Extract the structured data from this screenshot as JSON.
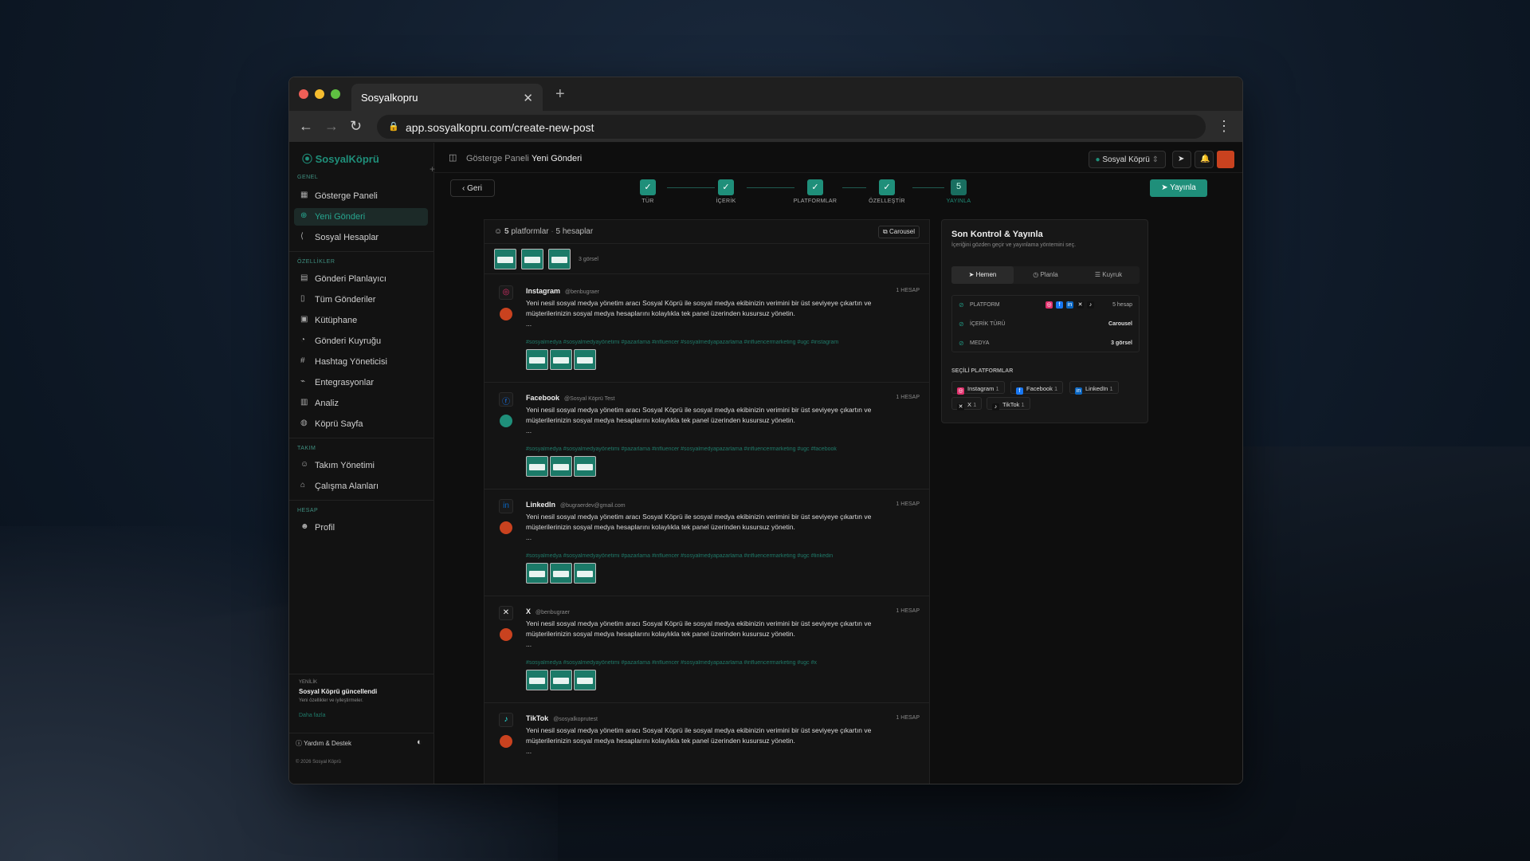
{
  "browser": {
    "tab_title": "Sosyalkopru",
    "url": "app.sosyalkopru.com/create-new-post"
  },
  "sidebar": {
    "logo": "SosyalKöprü",
    "sections": {
      "genel": "GENEL",
      "ozellikler": "ÖZELLİKLER",
      "takim": "TAKIM",
      "hesap": "HESAP"
    },
    "items": [
      {
        "label": "Gösterge Paneli"
      },
      {
        "label": "Yeni Gönderi"
      },
      {
        "label": "Sosyal Hesaplar"
      },
      {
        "label": "Gönderi Planlayıcı"
      },
      {
        "label": "Tüm Gönderiler"
      },
      {
        "label": "Kütüphane"
      },
      {
        "label": "Gönderi Kuyruğu"
      },
      {
        "label": "Hashtag Yöneticisi"
      },
      {
        "label": "Entegrasyonlar"
      },
      {
        "label": "Analiz"
      },
      {
        "label": "Köprü Sayfa"
      },
      {
        "label": "Takım Yönetimi"
      },
      {
        "label": "Çalışma Alanları"
      },
      {
        "label": "Profil"
      }
    ],
    "update": {
      "tag": "YENİLİK",
      "title": "Sosyal Köprü güncellendi",
      "desc": "Yeni özellikler ve iyileştirmeler.",
      "more": "Daha fazla"
    },
    "help": "Yardım & Destek",
    "copyright": "© 2026 Sosyal Köprü"
  },
  "topbar": {
    "crumb1": "Gösterge Paneli",
    "crumb2": "Yeni Gönderi",
    "workspace": "Sosyal Köprü"
  },
  "steps": [
    {
      "label": "TÜR"
    },
    {
      "label": "İÇERİK"
    },
    {
      "label": "PLATFORMLAR"
    },
    {
      "label": "ÖZELLEŞTİR"
    },
    {
      "label": "YAYINLA",
      "num": "5"
    }
  ],
  "back_label": "Geri",
  "publish_label": "Yayınla",
  "feed": {
    "platform_count": "5",
    "platform_word": "platformlar",
    "accounts": "5 hesaplar",
    "carousel": "Carousel",
    "images": "3 görsel",
    "posts": [
      {
        "platform": "Instagram",
        "handle": "@benbugraer",
        "acc": "1 HESAP",
        "text": "Yeni nesil sosyal medya yönetim aracı Sosyal Köprü ile sosyal medya ekibinizin verimini bir üst seviyeye çıkartın ve müşterilerinizin sosyal medya hesaplarını kolaylıkla tek panel üzerinden kusursuz yönetin.",
        "ellipsis": "...",
        "tags": "#sosyalmedya #sosyalmedyayönetimi #pazarlama #influencer #sosyalmedyapazarlama #influencermarketing #ugc #instagram"
      },
      {
        "platform": "Facebook",
        "handle": "@Sosyal Köprü Test",
        "acc": "1 HESAP",
        "text": "Yeni nesil sosyal medya yönetim aracı Sosyal Köprü ile sosyal medya ekibinizin verimini bir üst seviyeye çıkartın ve müşterilerinizin sosyal medya hesaplarını kolaylıkla tek panel üzerinden kusursuz yönetin.",
        "ellipsis": "...",
        "tags": "#sosyalmedya #sosyalmedyayönetimi #pazarlama #influencer #sosyalmedyapazarlama #influencermarketing #ugc #facebook"
      },
      {
        "platform": "LinkedIn",
        "handle": "@bugraerdev@gmail.com",
        "acc": "1 HESAP",
        "text": "Yeni nesil sosyal medya yönetim aracı Sosyal Köprü ile sosyal medya ekibinizin verimini bir üst seviyeye çıkartın ve müşterilerinizin sosyal medya hesaplarını kolaylıkla tek panel üzerinden kusursuz yönetin.",
        "ellipsis": "...",
        "tags": "#sosyalmedya #sosyalmedyayönetimi #pazarlama #influencer #sosyalmedyapazarlama #influencermarketing #ugc #linkedin"
      },
      {
        "platform": "X",
        "handle": "@benbugraer",
        "acc": "1 HESAP",
        "text": "Yeni nesil sosyal medya yönetim aracı Sosyal Köprü ile sosyal medya ekibinizin verimini bir üst seviyeye çıkartın ve müşterilerinizin sosyal medya hesaplarını kolaylıkla tek panel üzerinden kusursuz yönetin.",
        "ellipsis": "...",
        "tags": "#sosyalmedya #sosyalmedyayönetimi #pazarlama #influencer #sosyalmedyapazarlama #influencermarketing #ugc #x"
      },
      {
        "platform": "TikTok",
        "handle": "@sosyalkoprutest",
        "acc": "1 HESAP",
        "text": "Yeni nesil sosyal medya yönetim aracı Sosyal Köprü ile sosyal medya ekibinizin verimini bir üst seviyeye çıkartın ve müşterilerinizin sosyal medya hesaplarını kolaylıkla tek panel üzerinden kusursuz yönetin.",
        "ellipsis": "..."
      }
    ]
  },
  "panel": {
    "title": "Son Kontrol & Yayınla",
    "subtitle": "İçeriğini gözden geçir ve yayınlama yöntemini seç.",
    "tabs": [
      "Hemen",
      "Planla",
      "Kuyruk"
    ],
    "rows": [
      {
        "label": "PLATFORM",
        "value": "5 hesap"
      },
      {
        "label": "İÇERİK TÜRÜ",
        "value": "Carousel"
      },
      {
        "label": "MEDYA",
        "value": "3 görsel"
      }
    ],
    "selected_title": "SEÇİLİ PLATFORMLAR",
    "chips": [
      {
        "name": "Instagram",
        "n": "1"
      },
      {
        "name": "Facebook",
        "n": "1"
      },
      {
        "name": "LinkedIn",
        "n": "1"
      },
      {
        "name": "X",
        "n": "1"
      },
      {
        "name": "TikTok",
        "n": "1"
      }
    ]
  },
  "colors": {
    "accent": "#1f8f7a",
    "instagram": "#e1306c",
    "facebook": "#1877f2",
    "linkedin": "#0a66c2",
    "avatar": "#c9421f"
  }
}
